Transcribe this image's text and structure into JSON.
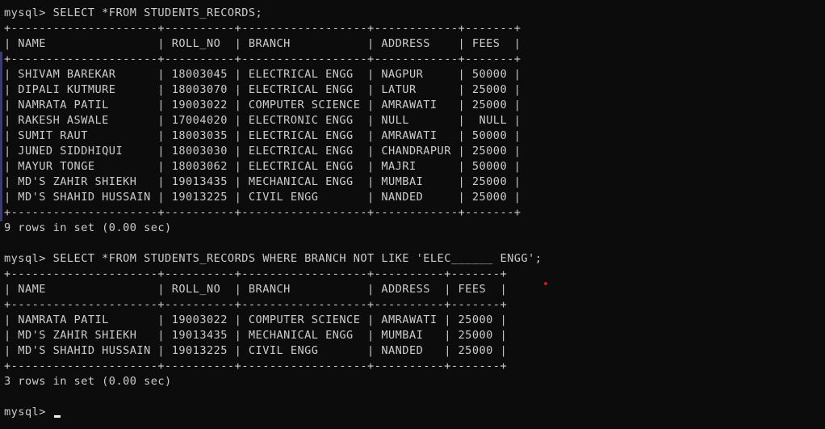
{
  "terminal": {
    "lines": [
      "mysql> SELECT *FROM STUDENTS_RECORDS;",
      "+---------------------+----------+------------------+------------+-------+",
      "| NAME                | ROLL_NO  | BRANCH           | ADDRESS    | FEES  |",
      "+---------------------+----------+------------------+------------+-------+",
      "| SHIVAM BAREKAR      | 18003045 | ELECTRICAL ENGG  | NAGPUR     | 50000 |",
      "| DIPALI KUTMURE      | 18003070 | ELECTRICAL ENGG  | LATUR      | 25000 |",
      "| NAMRATA PATIL       | 19003022 | COMPUTER SCIENCE | AMRAWATI   | 25000 |",
      "| RAKESH ASWALE       | 17004020 | ELECTRONIC ENGG  | NULL       |  NULL |",
      "| SUMIT RAUT          | 18003035 | ELECTRICAL ENGG  | AMRAWATI   | 50000 |",
      "| JUNED SIDDHIQUI     | 18003030 | ELECTRICAL ENGG  | CHANDRAPUR | 25000 |",
      "| MAYUR TONGE         | 18003062 | ELECTRICAL ENGG  | MAJRI      | 50000 |",
      "| MD'S ZAHIR SHIEKH   | 19013435 | MECHANICAL ENGG  | MUMBAI     | 25000 |",
      "| MD'S SHAHID HUSSAIN | 19013225 | CIVIL ENGG       | NANDED     | 25000 |",
      "+---------------------+----------+------------------+------------+-------+",
      "9 rows in set (0.00 sec)",
      "",
      "mysql> SELECT *FROM STUDENTS_RECORDS WHERE BRANCH NOT LIKE 'ELEC______ ENGG';",
      "+---------------------+----------+------------------+----------+-------+",
      "| NAME                | ROLL_NO  | BRANCH           | ADDRESS  | FEES  |",
      "+---------------------+----------+------------------+----------+-------+",
      "| NAMRATA PATIL       | 19003022 | COMPUTER SCIENCE | AMRAWATI | 25000 |",
      "| MD'S ZAHIR SHIEKH   | 19013435 | MECHANICAL ENGG  | MUMBAI   | 25000 |",
      "| MD'S SHAHID HUSSAIN | 19013225 | CIVIL ENGG       | NANDED   | 25000 |",
      "+---------------------+----------+------------------+----------+-------+",
      "3 rows in set (0.00 sec)",
      ""
    ],
    "prompt": "mysql> "
  },
  "colors": {
    "background": "#0c0c0c",
    "text": "#cccccc",
    "cursor": "#f2f2f2",
    "marker": "#d11a1a"
  }
}
